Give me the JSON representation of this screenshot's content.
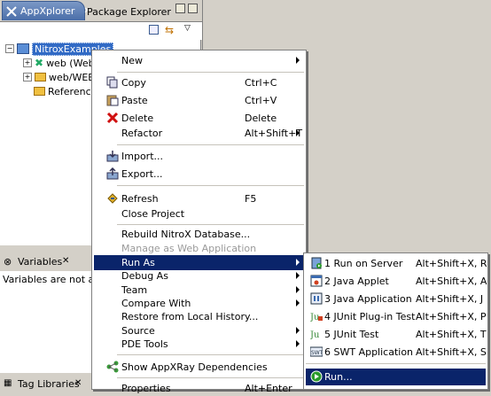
{
  "left_pane": {
    "tabs": [
      {
        "label": "AppXplorer",
        "active": true
      },
      {
        "label": "Package Explorer",
        "active": false
      }
    ],
    "tree": {
      "root": "NitroxExamples",
      "children": [
        {
          "label": "web (Web"
        },
        {
          "label": "web/WEB-"
        },
        {
          "label": "Reference"
        }
      ]
    },
    "variables_tab": "Variables",
    "variables_msg": "Variables are not avail",
    "bottom_tab": "Tag Libraries"
  },
  "context_menu": {
    "items": [
      {
        "label": "New",
        "accel": "",
        "submenu": true,
        "icon": "none"
      },
      {
        "label": "Copy",
        "accel": "Ctrl+C",
        "icon": "copy-icon"
      },
      {
        "label": "Paste",
        "accel": "Ctrl+V",
        "icon": "paste-icon"
      },
      {
        "label": "Delete",
        "accel": "Delete",
        "icon": "delete-icon"
      },
      {
        "label": "Refactor",
        "accel": "Alt+Shift+T",
        "submenu": true
      },
      {
        "label": "Import...",
        "icon": "import-icon"
      },
      {
        "label": "Export...",
        "icon": "export-icon"
      },
      {
        "label": "Refresh",
        "accel": "F5",
        "icon": "refresh-icon"
      },
      {
        "label": "Close Project"
      },
      {
        "label": "Rebuild NitroX Database..."
      },
      {
        "label": "Manage as Web Application",
        "disabled": true
      },
      {
        "label": "Run As",
        "submenu": true,
        "highlighted": true
      },
      {
        "label": "Debug As",
        "submenu": true
      },
      {
        "label": "Team",
        "submenu": true
      },
      {
        "label": "Compare With",
        "submenu": true
      },
      {
        "label": "Restore from Local History..."
      },
      {
        "label": "Source",
        "submenu": true
      },
      {
        "label": "PDE Tools",
        "submenu": true
      },
      {
        "label": "Show AppXRay Dependencies",
        "icon": "dependencies-icon"
      },
      {
        "label": "Properties",
        "accel": "Alt+Enter"
      }
    ]
  },
  "run_as_submenu": {
    "items": [
      {
        "label": "1 Run on Server",
        "accel": "Alt+Shift+X, R",
        "icon": "server-icon"
      },
      {
        "label": "2 Java Applet",
        "accel": "Alt+Shift+X, A",
        "icon": "applet-icon"
      },
      {
        "label": "3 Java Application",
        "accel": "Alt+Shift+X, J",
        "icon": "java-app-icon"
      },
      {
        "label": "4 JUnit Plug-in Test",
        "accel": "Alt+Shift+X, P",
        "icon": "junit-plugin-icon"
      },
      {
        "label": "5 JUnit Test",
        "accel": "Alt+Shift+X, T",
        "icon": "junit-icon"
      },
      {
        "label": "6 SWT Application",
        "accel": "Alt+Shift+X, S",
        "icon": "swt-icon"
      },
      {
        "label": "Run...",
        "accel": "",
        "icon": "run-icon",
        "highlighted": true
      }
    ]
  },
  "colors": {
    "menu_highlight": "#0a246a",
    "tree_selection": "#316ac5",
    "chrome": "#d4d0c8"
  }
}
